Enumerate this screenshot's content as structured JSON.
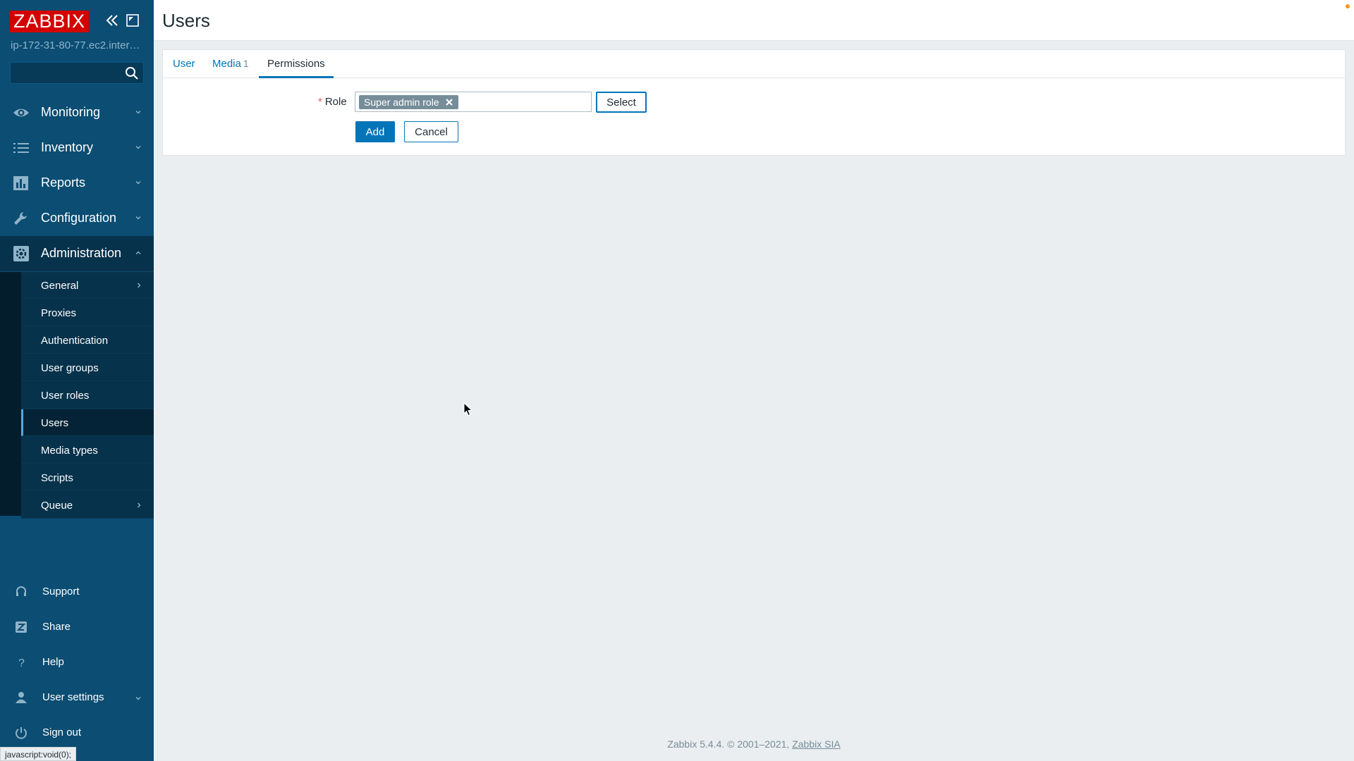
{
  "sidebar": {
    "logo": "ZABBIX",
    "server_name": "ip-172-31-80-77.ec2.inter…",
    "search_placeholder": "",
    "main_menu": [
      {
        "label": "Monitoring",
        "icon": "eye-icon"
      },
      {
        "label": "Inventory",
        "icon": "list-icon"
      },
      {
        "label": "Reports",
        "icon": "bar-chart-icon"
      },
      {
        "label": "Configuration",
        "icon": "wrench-icon"
      },
      {
        "label": "Administration",
        "icon": "gear-icon"
      }
    ],
    "admin_submenu": [
      {
        "label": "General"
      },
      {
        "label": "Proxies"
      },
      {
        "label": "Authentication"
      },
      {
        "label": "User groups"
      },
      {
        "label": "User roles"
      },
      {
        "label": "Users"
      },
      {
        "label": "Media types"
      },
      {
        "label": "Scripts"
      },
      {
        "label": "Queue"
      }
    ],
    "bottom_menu": [
      {
        "label": "Support",
        "icon": "headset-icon"
      },
      {
        "label": "Share",
        "icon": "share-icon"
      },
      {
        "label": "Help",
        "icon": "help-icon"
      },
      {
        "label": "User settings",
        "icon": "user-icon"
      },
      {
        "label": "Sign out",
        "icon": "power-icon"
      }
    ]
  },
  "header": {
    "title": "Users"
  },
  "tabs": [
    {
      "label": "User",
      "count": ""
    },
    {
      "label": "Media",
      "count": "1"
    },
    {
      "label": "Permissions",
      "count": ""
    }
  ],
  "form": {
    "role_label": "Role",
    "role_required_mark": "*",
    "role_value": "Super admin role",
    "select_label": "Select",
    "add_label": "Add",
    "cancel_label": "Cancel"
  },
  "footer": {
    "text": "Zabbix 5.4.4. © 2001–2021, ",
    "link": "Zabbix SIA"
  },
  "status_tip": "javascript:void(0);",
  "colors": {
    "sidebar_bg": "#0b4d73",
    "logo_bg": "#d40000",
    "accent": "#0275b8",
    "page_bg": "#ebeef0"
  }
}
